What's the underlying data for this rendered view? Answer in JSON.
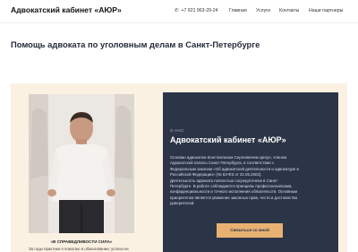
{
  "header": {
    "brand": "Адвокатский кабинет «АЮР»",
    "phone": "+7 921 963-29-24",
    "nav": [
      "Главная",
      "Услуги",
      "Контакты",
      "Наши партнеры"
    ]
  },
  "page": {
    "title": "Помощь адвоката по уголовным делам в Санкт-Петербурге"
  },
  "about": {
    "kicker": "О НАС",
    "title": "Адвокатский кабинет «АЮР»",
    "paragraphs": [
      "Основан адвокатом Константином Сергеевичем Цепул, членом",
      "Адвокатской палаты Санкт-Петербурга, в соответствии с",
      "Федеральным законом «Об адвокатской деятельности и адвокатуре в",
      "Российской Федерации» (№ 63-ФЗ от 31.05.2002).",
      "Деятельность адвоката полностью сосредоточена в Санкт-",
      "Петербурге. В работе соблюдаются принципы профессионализма,",
      "конфиденциальности и точного исполнения обязательств. Основным",
      "приоритетом является уважение законных прав, чести и достоинства",
      "доверителей."
    ],
    "cta": "Связаться со мной"
  },
  "photo": {
    "quote": "«В СПРАВЕДЛИВОСТИ СИЛА»",
    "caption": "За годы практики я помогаю в обжаловании; успеха не"
  },
  "colors": {
    "card_bg": "#2c3547",
    "section_bg": "#fbf1e2",
    "accent": "#e8b172"
  },
  "icons": {
    "phone": "phone-icon"
  }
}
